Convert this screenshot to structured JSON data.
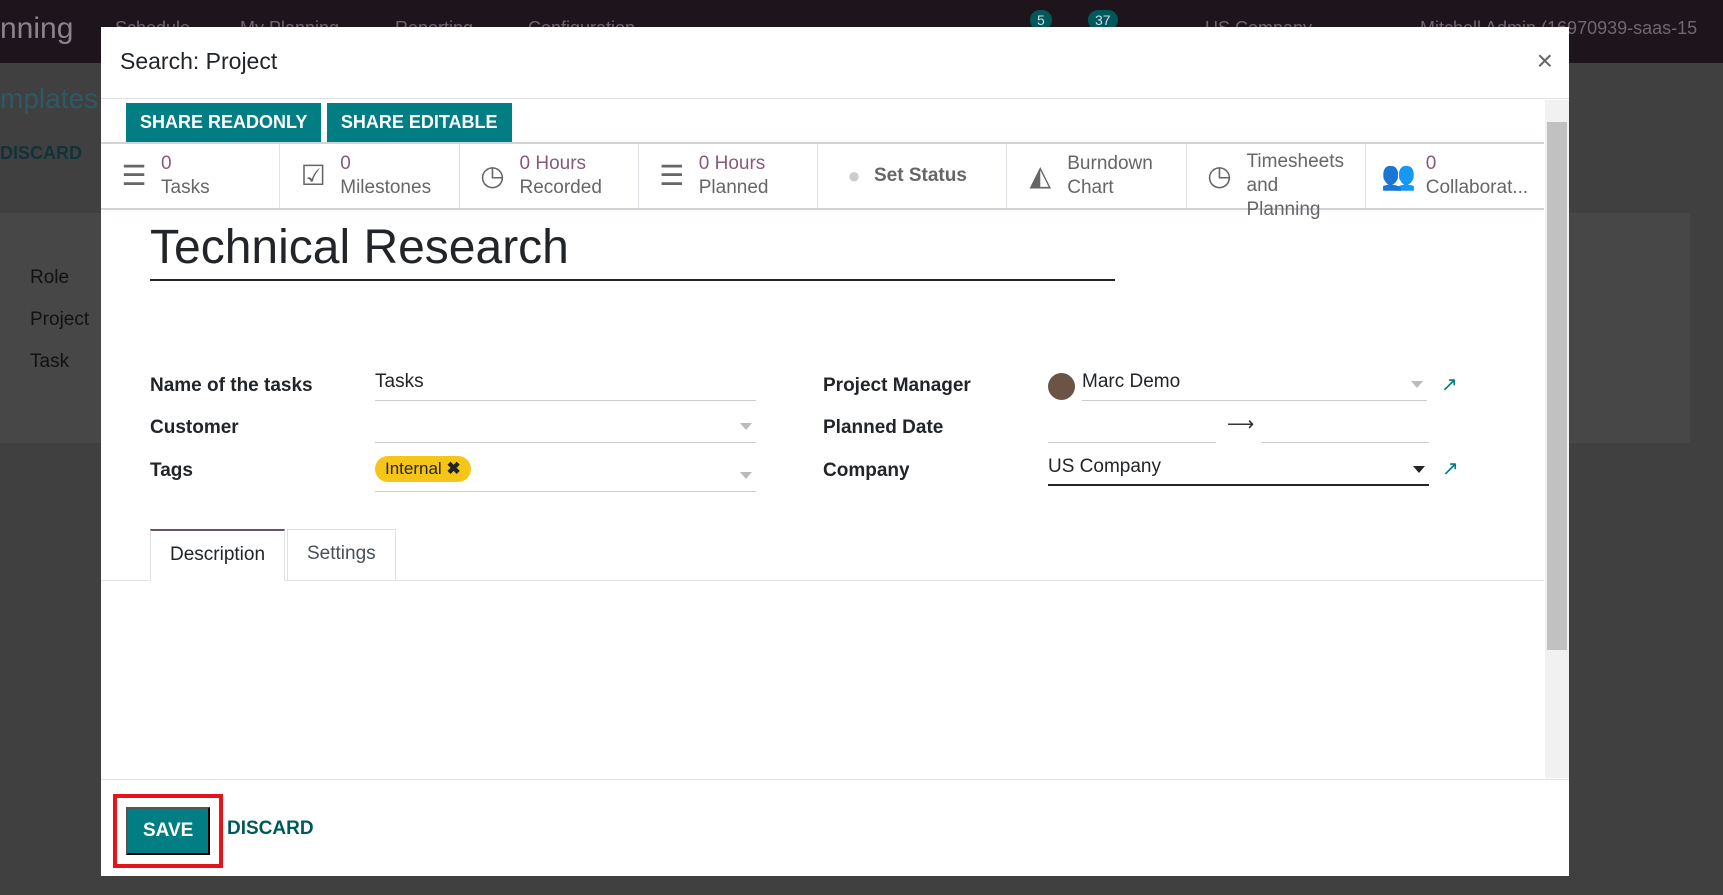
{
  "navbar": {
    "brand": "nning",
    "menu": [
      "Schedule",
      "My Planning",
      "Reporting",
      "Configuration"
    ],
    "badges": [
      "5",
      "37"
    ],
    "company": "US Company",
    "user": "Mitchell Admin (16970939-saas-15"
  },
  "background": {
    "breadcrumb": "mplates /",
    "discard": "DISCARD",
    "labels": [
      "Role",
      "Project",
      "Task"
    ]
  },
  "modal": {
    "title": "Search: Project",
    "close": "×",
    "share_readonly": "SHARE READONLY",
    "share_editable": "SHARE EDITABLE",
    "stats": [
      {
        "icon": "tasks-icon",
        "value": "0",
        "label": "Tasks"
      },
      {
        "icon": "check-square-icon",
        "value": "0",
        "label": "Milestones"
      },
      {
        "icon": "clock-icon",
        "value": "0 Hours",
        "label": "Recorded"
      },
      {
        "icon": "tasks-icon",
        "value": "0 Hours",
        "label": "Planned"
      },
      {
        "icon": "circle-icon",
        "value": "",
        "label": "Set Status"
      },
      {
        "icon": "area-chart-icon",
        "value": "",
        "label": "Burndown Chart"
      },
      {
        "icon": "clock-icon",
        "value": "",
        "label": "Timesheets and Planning"
      },
      {
        "icon": "users-icon",
        "value": "0",
        "label": "Collaborat..."
      }
    ],
    "project_name": "Technical Research",
    "fields": {
      "name_of_tasks": {
        "label": "Name of the tasks",
        "value": "Tasks"
      },
      "customer": {
        "label": "Customer",
        "value": ""
      },
      "tags": {
        "label": "Tags",
        "value": "Internal"
      },
      "project_manager": {
        "label": "Project Manager",
        "value": "Marc Demo"
      },
      "planned_date": {
        "label": "Planned Date",
        "arrow": "⟶"
      },
      "company": {
        "label": "Company",
        "value": "US Company"
      }
    },
    "tabs": [
      "Description",
      "Settings"
    ],
    "save": "SAVE",
    "discard": "DISCARD"
  },
  "colors": {
    "primary": "#017e84",
    "stat_value": "#875a7b",
    "tag": "#f5c518",
    "highlight": "#e3141b"
  }
}
